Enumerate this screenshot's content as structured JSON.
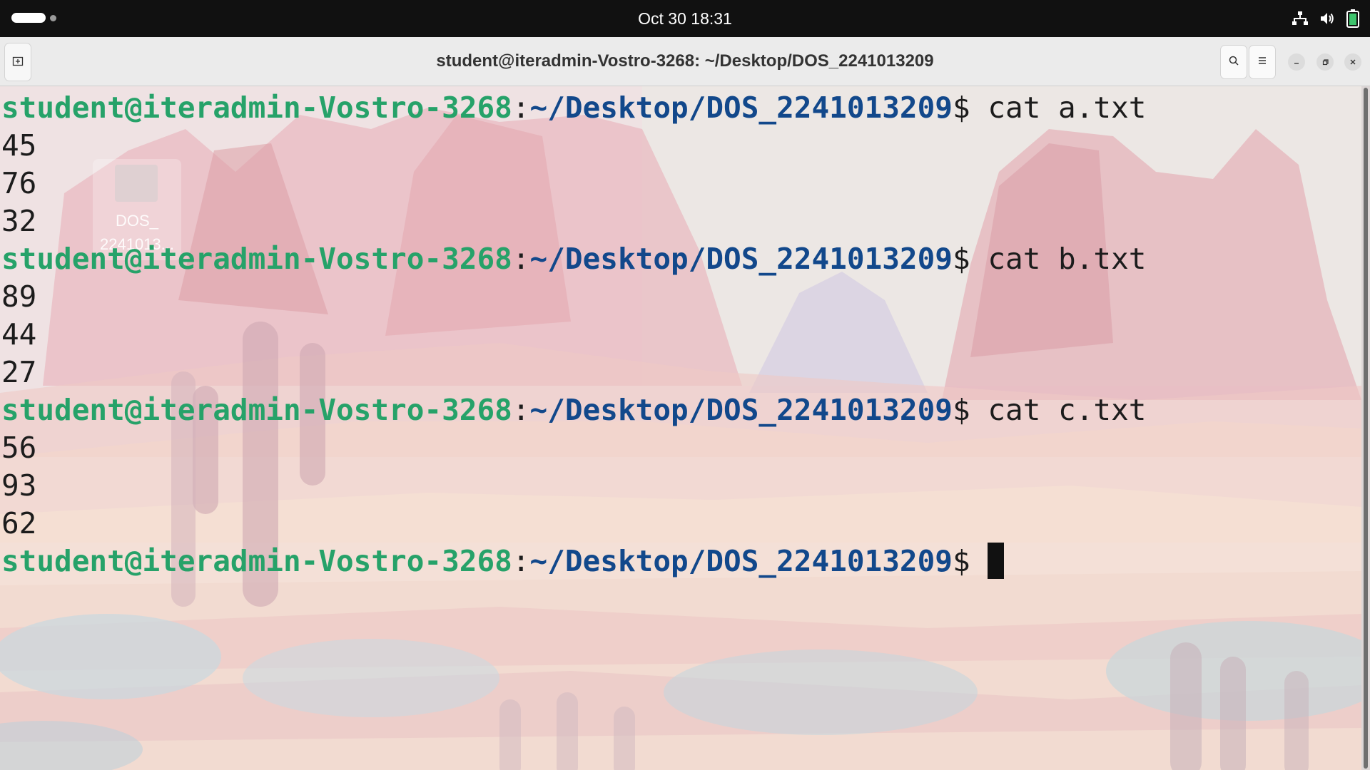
{
  "topbar": {
    "clock": "Oct 30  18:31",
    "tray_icons": [
      "network-icon",
      "volume-icon",
      "battery-icon"
    ]
  },
  "window": {
    "title": "student@iteradmin-Vostro-3268: ~/Desktop/DOS_2241013209",
    "buttons": [
      "new-tab-icon",
      "search-icon",
      "menu-icon",
      "minimize-icon",
      "maximize-icon",
      "close-icon"
    ]
  },
  "desktop_icon": {
    "label_line1": "DOS_",
    "label_line2": "2241013..."
  },
  "terminal": {
    "prompt_user": "student@iteradmin-Vostro-3268",
    "prompt_colon": ":",
    "prompt_path": "~/Desktop/DOS_2241013209",
    "prompt_dollar": "$",
    "lines": [
      {
        "type": "prompt",
        "command": " cat a.txt"
      },
      {
        "type": "output",
        "text": "45"
      },
      {
        "type": "output",
        "text": "76"
      },
      {
        "type": "output",
        "text": "32"
      },
      {
        "type": "prompt",
        "command": " cat b.txt"
      },
      {
        "type": "output",
        "text": "89"
      },
      {
        "type": "output",
        "text": "44"
      },
      {
        "type": "output",
        "text": "27"
      },
      {
        "type": "prompt",
        "command": " cat c.txt"
      },
      {
        "type": "output",
        "text": "56"
      },
      {
        "type": "output",
        "text": "93"
      },
      {
        "type": "output",
        "text": "62"
      },
      {
        "type": "prompt",
        "command": ""
      }
    ]
  },
  "colors": {
    "prompt_user": "#26a269",
    "prompt_path": "#12488b",
    "topbar_bg": "#111111"
  }
}
